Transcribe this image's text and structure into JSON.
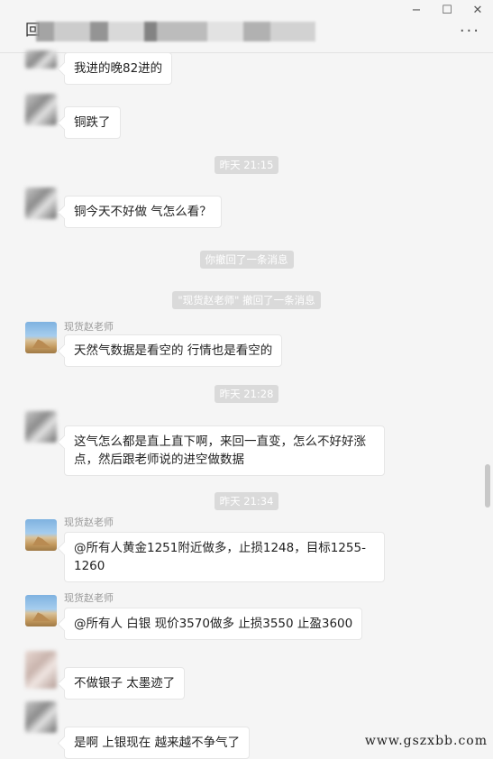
{
  "window": {
    "minimize": "−",
    "maximize": "☐",
    "close": "✕",
    "title": "回",
    "more_icon": "···"
  },
  "messages": [
    {
      "kind": "msg",
      "sender": "",
      "text": "我进的晚82进的",
      "avatar": "blurred"
    },
    {
      "kind": "msg",
      "sender": "",
      "text": "铜跌了",
      "avatar": "blurred"
    },
    {
      "kind": "time",
      "text": "昨天 21:15"
    },
    {
      "kind": "msg",
      "sender": "",
      "text": "铜今天不好做  气怎么看？",
      "avatar": "blurred"
    },
    {
      "kind": "sys",
      "text": "你撤回了一条消息"
    },
    {
      "kind": "sys",
      "text": "\"现货赵老师\" 撤回了一条消息"
    },
    {
      "kind": "msg",
      "sender": "现货赵老师",
      "text": "天然气数据是看空的  行情也是看空的",
      "avatar": "sphinx"
    },
    {
      "kind": "time",
      "text": "昨天 21:28"
    },
    {
      "kind": "msg",
      "sender": "",
      "text": "这气怎么都是直上直下啊，来回一直变，怎么不好好涨点，然后跟老师说的进空做数据",
      "avatar": "blurred"
    },
    {
      "kind": "time",
      "text": "昨天 21:34"
    },
    {
      "kind": "msg",
      "sender": "现货赵老师",
      "text": "@所有人黄金1251附近做多，止损1248，目标1255-1260",
      "avatar": "sphinx"
    },
    {
      "kind": "msg",
      "sender": "现货赵老师",
      "text": "@所有人  白银 现价3570做多  止损3550  止盈3600",
      "avatar": "sphinx"
    },
    {
      "kind": "msg",
      "sender": "",
      "text": "不做银子 太墨迹了",
      "avatar": "blurred-pink"
    },
    {
      "kind": "msg",
      "sender": "",
      "text": "是啊 上银现在 越来越不争气了",
      "avatar": "blurred"
    }
  ],
  "watermark": "www.gszxbb.com"
}
